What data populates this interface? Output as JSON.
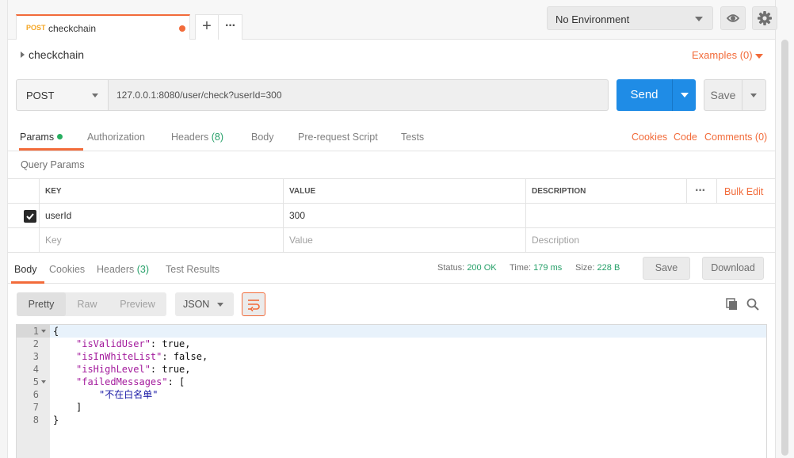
{
  "tab": {
    "method": "POST",
    "name": "checkchain"
  },
  "environment": {
    "selected": "No Environment"
  },
  "request": {
    "title": "checkchain",
    "examples_label": "Examples (0)",
    "method": "POST",
    "url": "127.0.0.1:8080/user/check?userId=300",
    "send_label": "Send",
    "save_label": "Save"
  },
  "request_tabs": {
    "params": "Params",
    "authorization": "Authorization",
    "headers": "Headers",
    "headers_count": "(8)",
    "body": "Body",
    "prerequest": "Pre-request Script",
    "tests": "Tests",
    "cookies": "Cookies",
    "code": "Code",
    "comments": "Comments (0)"
  },
  "query_params": {
    "title": "Query Params",
    "headers": {
      "key": "KEY",
      "value": "VALUE",
      "description": "DESCRIPTION",
      "bulk_edit": "Bulk Edit"
    },
    "rows": [
      {
        "key": "userId",
        "value": "300",
        "description": "",
        "checked": true
      }
    ],
    "placeholders": {
      "key": "Key",
      "value": "Value",
      "description": "Description"
    }
  },
  "response": {
    "tabs": {
      "body": "Body",
      "cookies": "Cookies",
      "headers": "Headers",
      "headers_count": "(3)",
      "test_results": "Test Results"
    },
    "status_label": "Status:",
    "status_value": "200 OK",
    "time_label": "Time:",
    "time_value": "179 ms",
    "size_label": "Size:",
    "size_value": "228 B",
    "save_label": "Save",
    "download_label": "Download"
  },
  "body_view": {
    "modes": [
      "Pretty",
      "Raw",
      "Preview"
    ],
    "active_mode": "Pretty",
    "format": "JSON"
  },
  "code_lines": [
    {
      "n": "1",
      "text": "{"
    },
    {
      "n": "2",
      "text": "\"isValidUser\": true,"
    },
    {
      "n": "3",
      "text": "\"isInWhiteList\": false,"
    },
    {
      "n": "4",
      "text": "\"isHighLevel\": true,"
    },
    {
      "n": "5",
      "text": "\"failedMessages\": ["
    },
    {
      "n": "6",
      "text": "\"不在白名单\""
    },
    {
      "n": "7",
      "text": "]"
    },
    {
      "n": "8",
      "text": "}"
    }
  ],
  "colors": {
    "accent": "#f26b3a",
    "send": "#1f8ce6",
    "success": "#26a069",
    "json_key": "#a31a9c",
    "json_string": "#1a1aa6"
  }
}
